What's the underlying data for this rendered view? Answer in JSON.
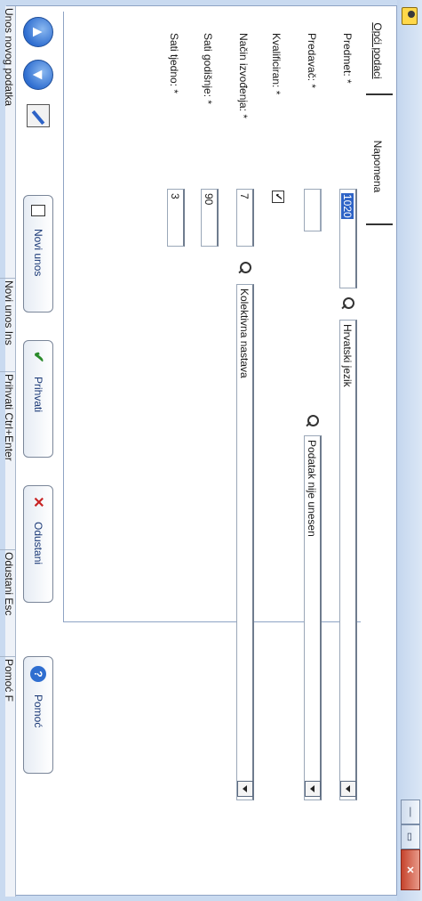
{
  "window": {
    "min_glyph": "—",
    "max_glyph": "▭",
    "close_glyph": "✕"
  },
  "tabs": [
    {
      "label": "Opći podaci",
      "active": true
    },
    {
      "label": "Napomena",
      "active": false
    }
  ],
  "form": {
    "predmet": {
      "label": "Predmet: *",
      "code": "1020",
      "value": "Hrvatski jezik"
    },
    "predavac": {
      "label": "Predavač: *",
      "value": "Podatak nije unesen"
    },
    "kvalificiran": {
      "label": "Kvalificiran: *",
      "checked": true,
      "check_glyph": "✓"
    },
    "nacin": {
      "label": "Način izvođenja: *",
      "code": "7",
      "value": "Kolektivna nastava"
    },
    "sati_godisnje": {
      "label": "Sati godišnje: *",
      "value": "90"
    },
    "sati_tjedno": {
      "label": "Sati tjedno: *",
      "value": "3"
    }
  },
  "nav": {
    "up_glyph": "▲",
    "down_glyph": "▼"
  },
  "actions": [
    {
      "label": "Novi unos",
      "icon": "document-icon"
    },
    {
      "label": "Prihvati",
      "icon": "check-icon",
      "glyph": "✔"
    },
    {
      "label": "Odustani",
      "icon": "close-icon",
      "glyph": "✕"
    },
    {
      "label": "Pomoć",
      "icon": "help-icon",
      "glyph": "?"
    }
  ],
  "status_bar": [
    "Unos novog podatka",
    "Novi unos Ins",
    "Prihvati Ctrl+Enter",
    "Odustani Esc",
    "Pomoć F"
  ],
  "colors": {
    "accent": "#2f6ed0",
    "close": "#c6442d",
    "selection": "#2e63c6"
  }
}
